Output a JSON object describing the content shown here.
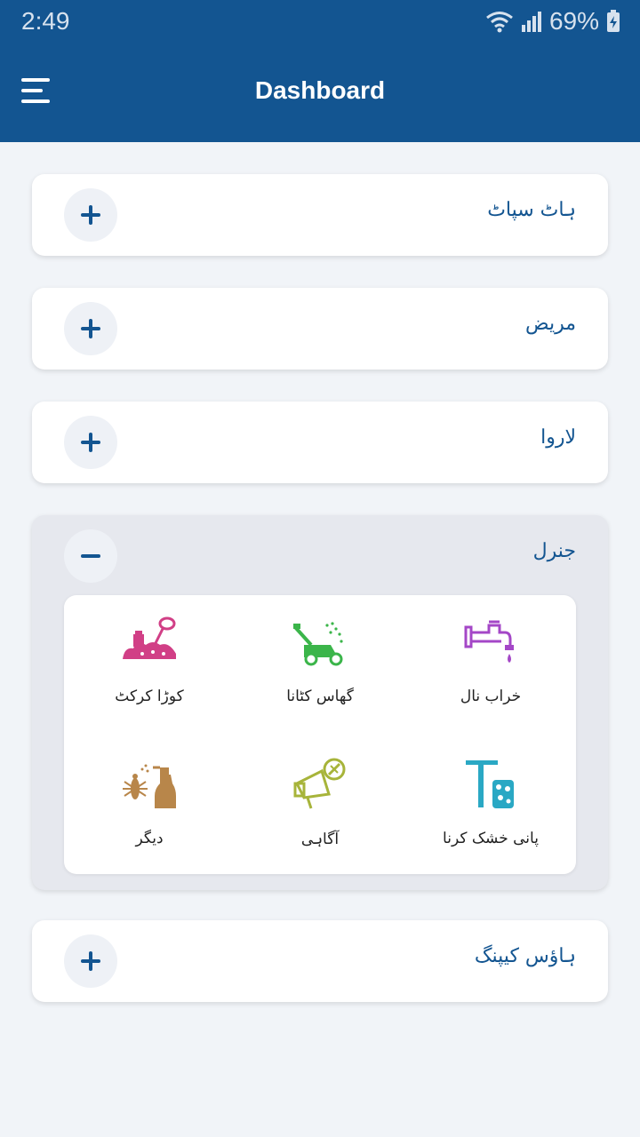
{
  "status_bar": {
    "time": "2:49",
    "battery": "69%",
    "icons": [
      "wifi-icon",
      "signal-icon",
      "battery-charging-icon"
    ]
  },
  "app_bar": {
    "title": "Dashboard",
    "menu_icon": "menu-icon"
  },
  "colors": {
    "primary": "#135591",
    "background": "#f1f4f8",
    "card_expanded": "#e6e8ee"
  },
  "sections": [
    {
      "label": "ہاٹ سپاٹ",
      "expanded": false,
      "toggle": "plus-icon"
    },
    {
      "label": "مریض",
      "expanded": false,
      "toggle": "plus-icon"
    },
    {
      "label": "لاروا",
      "expanded": false,
      "toggle": "plus-icon"
    },
    {
      "label": "جنرل",
      "expanded": true,
      "toggle": "minus-icon",
      "items": [
        {
          "label": "خراب نال",
          "icon": "leaking-tap-icon",
          "color": "#a447c7"
        },
        {
          "label": "گھاس کٹانا",
          "icon": "lawn-mower-icon",
          "color": "#3bb54a"
        },
        {
          "label": "کوڑا کرکٹ",
          "icon": "garbage-pile-icon",
          "color": "#d13f86"
        },
        {
          "label": "پانی خشک کرنا",
          "icon": "squeegee-sponge-icon",
          "color": "#2aa8c4"
        },
        {
          "label": "آگاہی",
          "icon": "megaphone-mosquito-icon",
          "color": "#a7b43a"
        },
        {
          "label": "دیگر",
          "icon": "insect-spray-icon",
          "color": "#b8864a"
        }
      ]
    },
    {
      "label": "ہاؤس کیپنگ",
      "expanded": false,
      "toggle": "plus-icon"
    }
  ]
}
